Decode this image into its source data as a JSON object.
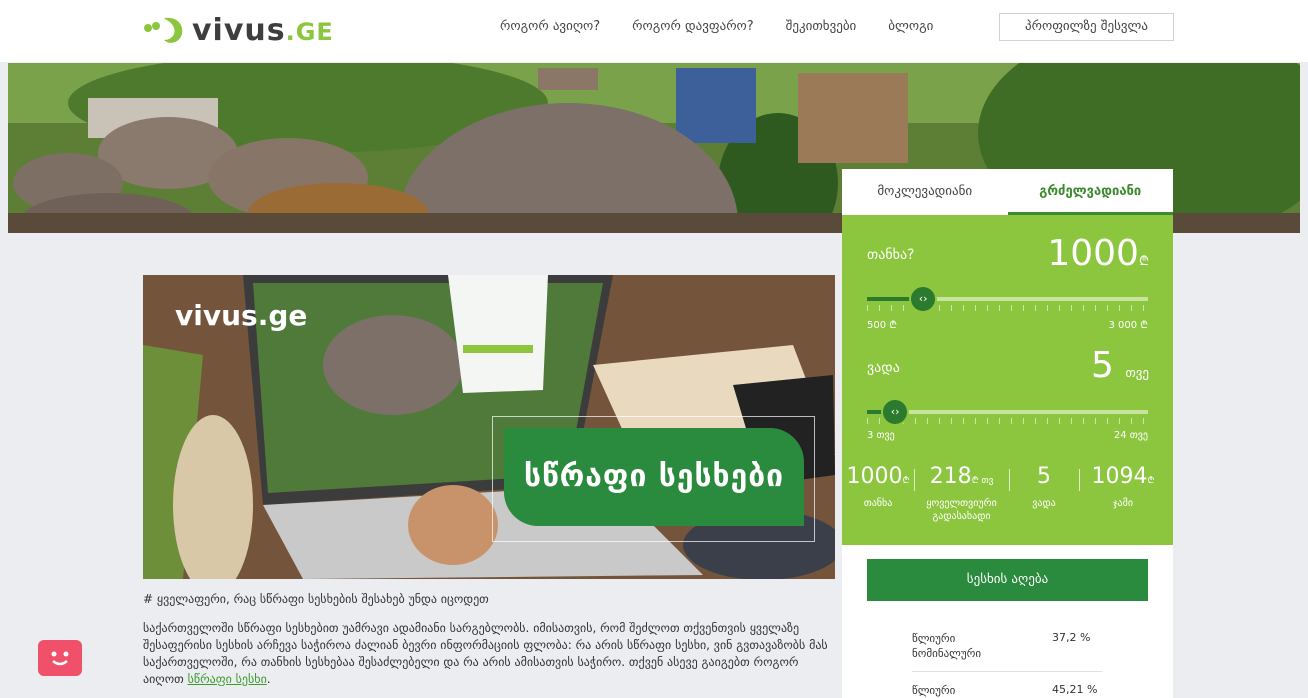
{
  "brand": {
    "name": "vivus",
    "tld": ".GE",
    "accent": "#8cc63f",
    "dark_green": "#2a8a3e"
  },
  "nav": {
    "items": [
      "როგორ ავიღო?",
      "როგორ დავფარო?",
      "შეკითხვები",
      "ბლოგი"
    ],
    "profile_label": "პროფილზე შესვლა"
  },
  "banner": {
    "text": "სწრაფი სესხები",
    "logo_text": "vivus.ge"
  },
  "article": {
    "meta": "# ყველაფერი, რაც სწრაფი სესხების შესახებ უნდა იცოდეთ",
    "body": "საქართველოში სწრაფი სესხებით უამრავი ადამიანი სარგებლობს. იმისათვის, რომ შეძლოთ თქვენთვის ყველაზე შესაფერისი სესხის არჩევა საჭიროა ძალიან ბევრი ინფორმაციის ფლობა: რა არის სწრაფი სესხი, ვინ გვთავაზობს მას საქართველოში, რა თანხის სესხებაა შესაძლებელი და რა არის ამისათვის საჭირო. თქვენ ასევე გაიგებთ როგორ აიღოთ",
    "link": "სწრაფი სესხი",
    "tail": "."
  },
  "calculator": {
    "tabs": [
      "მოკლევადიანი",
      "გრძელვადიანი"
    ],
    "active_tab": 1,
    "amount": {
      "label": "თანხა?",
      "value": "1000",
      "unit": "₾",
      "min": "500 ₾",
      "max": "3 000 ₾",
      "position": 0.2
    },
    "term": {
      "label": "ვადა",
      "value": "5",
      "unit": "თვე",
      "min": "3 თვე",
      "max": "24 თვე",
      "position": 0.1
    },
    "summary": [
      {
        "value": "1000",
        "unit": "₾",
        "label": "თანხა"
      },
      {
        "value": "218",
        "unit": "₾ თვ",
        "label": "ყოველთვიური გადასახადი"
      },
      {
        "value": "5",
        "unit": "",
        "label": "ვადა"
      },
      {
        "value": "1094",
        "unit": "₾",
        "label": "ჯამი"
      }
    ],
    "cta": "სესხის აღება",
    "rates": [
      {
        "label": "წლიური ნომინალური",
        "value": "37,2 %"
      },
      {
        "label": "წლიური",
        "value": "45,21 %"
      }
    ]
  }
}
